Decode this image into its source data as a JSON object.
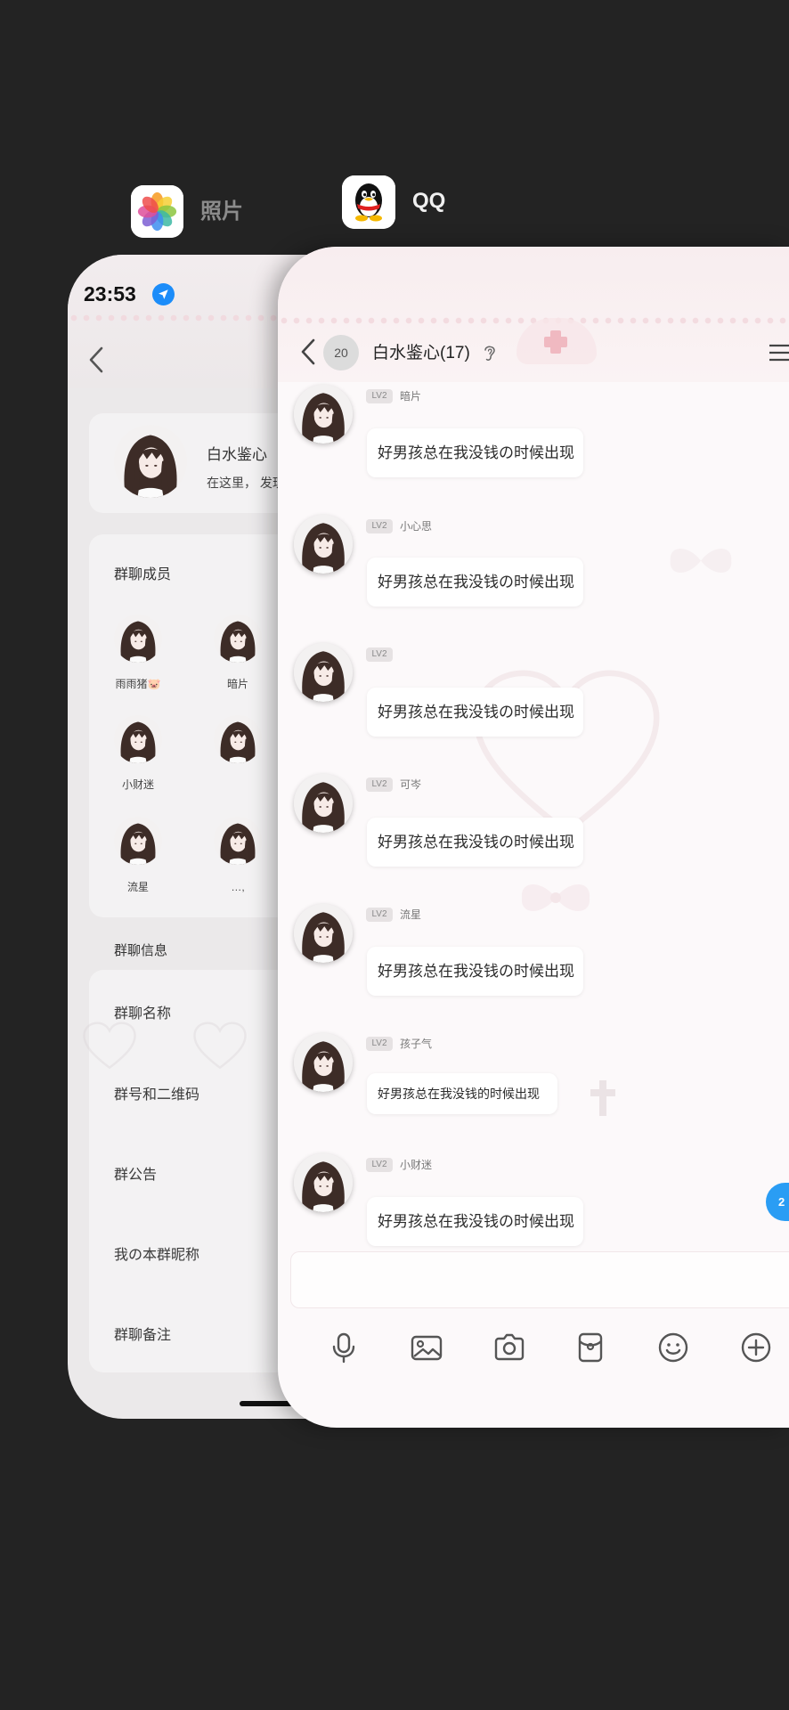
{
  "switcher": {
    "photos_app": {
      "label": "照片",
      "icon": "photos-app-icon"
    },
    "qq_app": {
      "label": "QQ",
      "icon": "qq-app-icon"
    }
  },
  "photos_card": {
    "status_time": "23:53",
    "status_icon": "location-arrow-icon",
    "profile": {
      "name": "白水鉴心",
      "subtitle": "在这里， 发现"
    },
    "members_title": "群聊成员",
    "members": [
      {
        "name": "雨雨猪🐷"
      },
      {
        "name": "暗片"
      },
      {
        "name": "小财迷"
      },
      {
        "name": ""
      },
      {
        "name": "流星"
      },
      {
        "name": "…,"
      }
    ],
    "info_title": "群聊信息",
    "settings": [
      {
        "label": "群聊名称"
      },
      {
        "label": "群号和二维码"
      },
      {
        "label": "群公告"
      },
      {
        "label": "我の本群昵称"
      },
      {
        "label": "群聊备注"
      }
    ]
  },
  "qq_card": {
    "header": {
      "unread_badge": "20",
      "title": "白水鉴心(17)"
    },
    "messages": [
      {
        "level": "LV2",
        "sender": "暗片",
        "text": "好男孩总在我没钱の时候出现"
      },
      {
        "level": "LV2",
        "sender": "小心思",
        "text": "好男孩总在我没钱の时候出现"
      },
      {
        "level": "LV2",
        "sender": "",
        "text": "好男孩总在我没钱の时候出现"
      },
      {
        "level": "LV2",
        "sender": "可岑",
        "text": "好男孩总在我没钱の时候出现"
      },
      {
        "level": "LV2",
        "sender": "流星",
        "text": "好男孩总在我没钱の时候出现"
      },
      {
        "level": "LV2",
        "sender": "孩子气",
        "text": "好男孩总在我没钱的时候出现"
      },
      {
        "level": "LV2",
        "sender": "小财迷",
        "text": "好男孩总在我没钱の时候出现"
      }
    ],
    "new_message_badge": "2",
    "toolbar_icons": [
      "microphone-icon",
      "image-icon",
      "camera-icon",
      "red-packet-icon",
      "emoji-icon",
      "add-icon"
    ]
  },
  "colors": {
    "background": "#232323",
    "photos_card": "#ebe9ea",
    "qq_card": "#fcf9fa",
    "location_blue": "#1c8cf9",
    "new_message_blue": "#2a9df4"
  }
}
